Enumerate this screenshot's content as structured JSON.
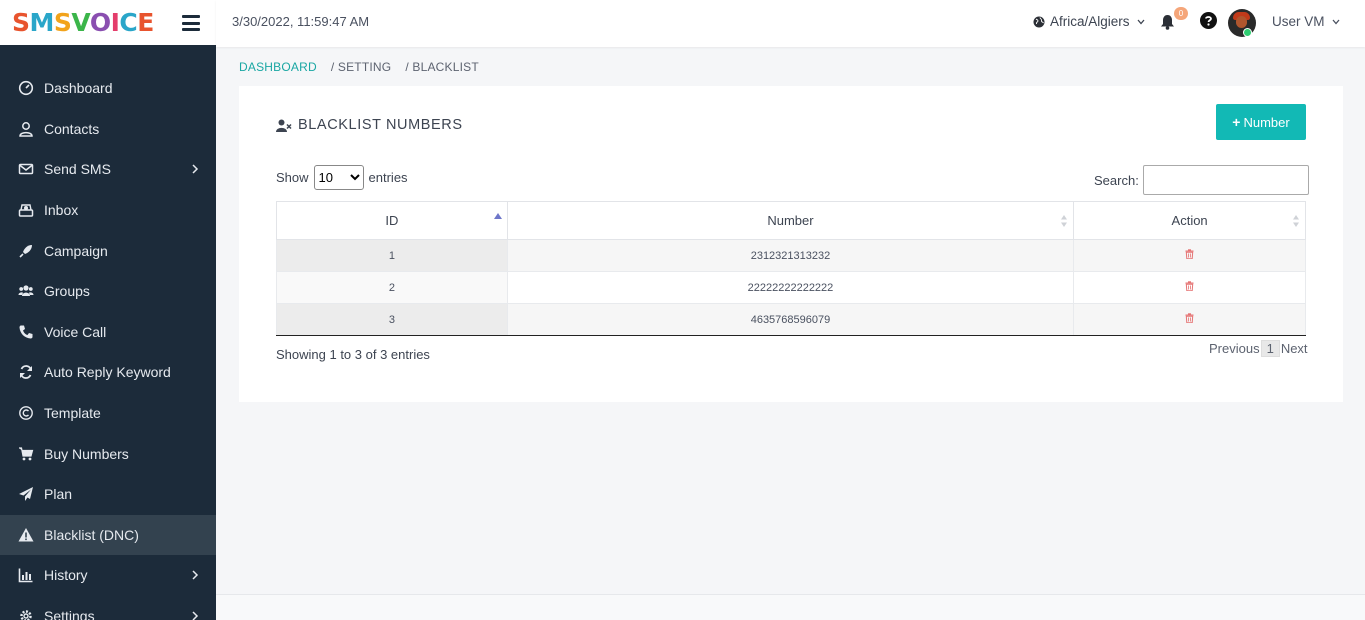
{
  "brand": {
    "logo": "SMSVOICE"
  },
  "topbar": {
    "datetime": "3/30/2022, 11:59:47 AM",
    "timezone": "Africa/Algiers",
    "notification_count": "0",
    "user": "User VM"
  },
  "sidebar": {
    "items": [
      {
        "label": "Dashboard",
        "icon": "dashboard-icon"
      },
      {
        "label": "Contacts",
        "icon": "user-icon"
      },
      {
        "label": "Send SMS",
        "icon": "envelope-icon"
      },
      {
        "label": "Inbox",
        "icon": "inbox-icon"
      },
      {
        "label": "Campaign",
        "icon": "rocket-icon"
      },
      {
        "label": "Groups",
        "icon": "users-icon"
      },
      {
        "label": "Voice Call",
        "icon": "phone-icon"
      },
      {
        "label": "Auto Reply Keyword",
        "icon": "sync-icon"
      },
      {
        "label": "Template",
        "icon": "copyright-icon"
      },
      {
        "label": "Buy Numbers",
        "icon": "cart-icon"
      },
      {
        "label": "Plan",
        "icon": "paper-plane-icon"
      },
      {
        "label": "Blacklist (DNC)",
        "icon": "warning-icon"
      },
      {
        "label": "History",
        "icon": "chart-icon"
      },
      {
        "label": "Settings",
        "icon": "gear-icon"
      }
    ]
  },
  "breadcrumb": {
    "home": "DASHBOARD",
    "level1": "/ SETTING",
    "level2": "/ BLACKLIST"
  },
  "card": {
    "title": "BLACKLIST NUMBERS",
    "add_button": "Number"
  },
  "controls": {
    "show_label": "Show",
    "entries_label": "entries",
    "page_size": "10",
    "search_label": "Search:"
  },
  "table": {
    "columns": [
      "ID",
      "Number",
      "Action"
    ],
    "rows": [
      {
        "id": "1",
        "number": "2312321313232"
      },
      {
        "id": "2",
        "number": "22222222222222"
      },
      {
        "id": "3",
        "number": "4635768596079"
      }
    ]
  },
  "footer_info": "Showing 1 to 3 of 3 entries",
  "pagination": {
    "previous": "Previous",
    "current": "1",
    "next": "Next"
  },
  "colors": {
    "sidebar": "#1c2b3a",
    "accent": "#12b9b5",
    "link": "#1aa7a3",
    "danger": "#e57373"
  }
}
